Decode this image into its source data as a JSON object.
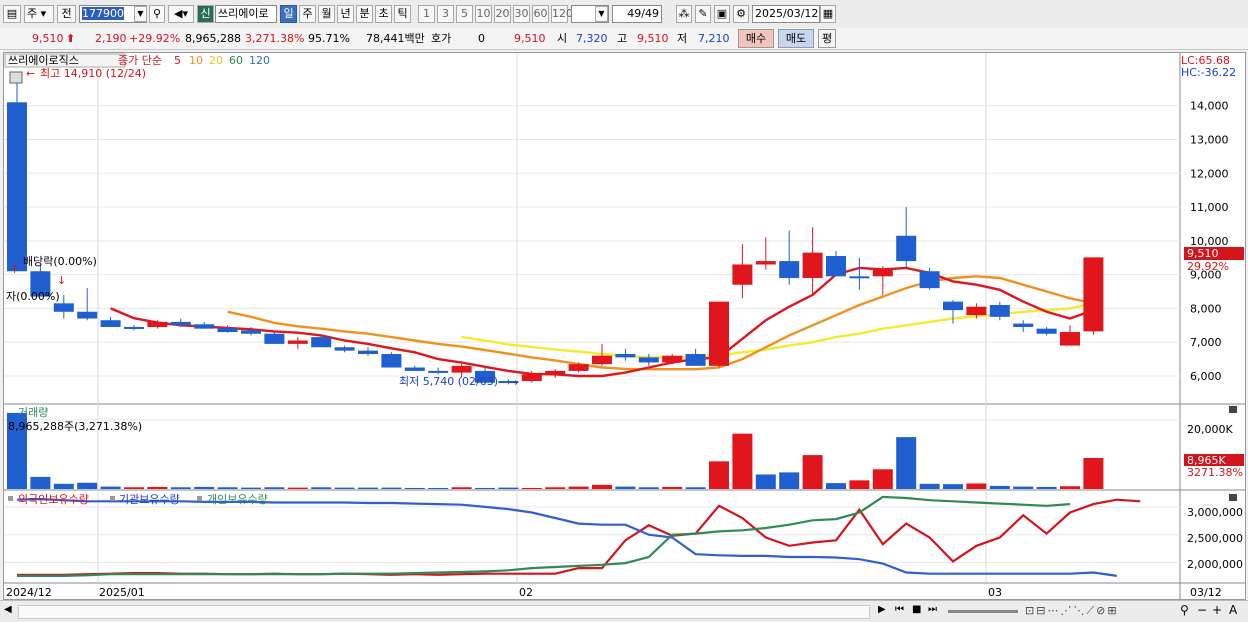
{
  "toolbar": {
    "market_type": "주",
    "mode": "전",
    "code": "177900",
    "badge_new": "신",
    "stock_name": "쓰리에이로",
    "periods": [
      "일",
      "주",
      "월",
      "년",
      "분",
      "초",
      "틱"
    ],
    "active_period": "일",
    "intervals": [
      "1",
      "3",
      "5",
      "10",
      "20",
      "30",
      "60",
      "120"
    ],
    "page_count": "49/49",
    "date": "2025/03/12"
  },
  "quote": {
    "price": "9,510",
    "change": "2,190",
    "change_pct": "+29.92%",
    "volume": "8,965,288",
    "volume_pct": "3,271.38%",
    "turnover_pct": "95.71%",
    "amount": "78,441백만",
    "hoga_label": "호가",
    "hoga_value": "0",
    "hoga_price": "9,510",
    "open_label": "시",
    "open": "7,320",
    "high_label": "고",
    "high": "9,510",
    "low_label": "저",
    "low": "7,210",
    "buy_button": "매수",
    "sell_button": "매도",
    "eval_button": "평"
  },
  "chart_header": {
    "stock_name": "쓰리에이로직스",
    "ma_label": "종가 단순",
    "ma_periods": [
      "5",
      "10",
      "20",
      "60",
      "120"
    ],
    "ma_colors": [
      "#e0161c",
      "#f0911e",
      "#f3ec2a",
      "#2e8b57",
      "#2f6bd6"
    ],
    "lc_label": "LC:65.68",
    "hc_label": "HC:-36.22"
  },
  "annotations": {
    "high_label": "최고 14,910 (12/24)",
    "low_label": "최저 5,740 (02/03)",
    "dividend_label": "배당락(0.00%)",
    "rights_label": "자(0.00%)"
  },
  "price_axis": {
    "ticks": [
      "14,000",
      "13,000",
      "12,000",
      "11,000",
      "10,000",
      "9,000",
      "8,000",
      "7,000",
      "6,000"
    ],
    "current_price_tag": "9,510",
    "current_pct_tag": "29.92%"
  },
  "volume_panel": {
    "title": "거래량",
    "subtitle": "8,965,288주(3,271.38%)",
    "axis_tick": "20,000K",
    "current_tag": "8,965K",
    "current_pct_tag": "3271.38%"
  },
  "holding_panel": {
    "legend": [
      "외국인보유수량",
      "기관보유수량",
      "개인보유수량"
    ],
    "axis_ticks": [
      "3,000,000",
      "2,500,000",
      "2,000,000"
    ]
  },
  "date_axis": [
    "2024/12",
    "2025/01",
    "02",
    "03",
    "03/12"
  ],
  "chart_data": {
    "type": "candlestick",
    "price": {
      "ylim": [
        5200,
        15500
      ],
      "candles": [
        {
          "o": 14100,
          "h": 14910,
          "l": 9100,
          "c": 9100
        },
        {
          "o": 9100,
          "h": 9300,
          "l": 8400,
          "c": 8350
        },
        {
          "o": 8150,
          "h": 8400,
          "l": 7700,
          "c": 7900
        },
        {
          "o": 7900,
          "h": 8600,
          "l": 7650,
          "c": 7700
        },
        {
          "o": 7650,
          "h": 7750,
          "l": 7450,
          "c": 7450
        },
        {
          "o": 7450,
          "h": 7500,
          "l": 7350,
          "c": 7420
        },
        {
          "o": 7450,
          "h": 7650,
          "l": 7400,
          "c": 7600
        },
        {
          "o": 7600,
          "h": 7700,
          "l": 7450,
          "c": 7500
        },
        {
          "o": 7530,
          "h": 7600,
          "l": 7400,
          "c": 7400
        },
        {
          "o": 7420,
          "h": 7500,
          "l": 7280,
          "c": 7300
        },
        {
          "o": 7350,
          "h": 7450,
          "l": 7200,
          "c": 7250
        },
        {
          "o": 7250,
          "h": 7300,
          "l": 6950,
          "c": 6950
        },
        {
          "o": 6950,
          "h": 7150,
          "l": 6800,
          "c": 7050
        },
        {
          "o": 7150,
          "h": 7200,
          "l": 6850,
          "c": 6850
        },
        {
          "o": 6850,
          "h": 6900,
          "l": 6700,
          "c": 6750
        },
        {
          "o": 6750,
          "h": 6850,
          "l": 6600,
          "c": 6650
        },
        {
          "o": 6650,
          "h": 6700,
          "l": 6250,
          "c": 6250
        },
        {
          "o": 6250,
          "h": 6300,
          "l": 6150,
          "c": 6150
        },
        {
          "o": 6150,
          "h": 6250,
          "l": 6050,
          "c": 6100
        },
        {
          "o": 6100,
          "h": 6350,
          "l": 5950,
          "c": 6300
        },
        {
          "o": 6150,
          "h": 6250,
          "l": 5740,
          "c": 5800
        },
        {
          "o": 5850,
          "h": 5900,
          "l": 5750,
          "c": 5800
        },
        {
          "o": 5850,
          "h": 6150,
          "l": 5800,
          "c": 6050
        },
        {
          "o": 6050,
          "h": 6200,
          "l": 5950,
          "c": 6150
        },
        {
          "o": 6150,
          "h": 6400,
          "l": 6100,
          "c": 6350
        },
        {
          "o": 6350,
          "h": 6950,
          "l": 6300,
          "c": 6600
        },
        {
          "o": 6650,
          "h": 6800,
          "l": 6450,
          "c": 6550
        },
        {
          "o": 6550,
          "h": 6650,
          "l": 6300,
          "c": 6400
        },
        {
          "o": 6400,
          "h": 6650,
          "l": 6350,
          "c": 6600
        },
        {
          "o": 6650,
          "h": 6800,
          "l": 6300,
          "c": 6300
        },
        {
          "o": 6300,
          "h": 8200,
          "l": 6250,
          "c": 8200
        },
        {
          "o": 8700,
          "h": 9900,
          "l": 8300,
          "c": 9300
        },
        {
          "o": 9300,
          "h": 10100,
          "l": 9150,
          "c": 9400
        },
        {
          "o": 9400,
          "h": 10300,
          "l": 8700,
          "c": 8900
        },
        {
          "o": 8900,
          "h": 10400,
          "l": 8400,
          "c": 9650
        },
        {
          "o": 9550,
          "h": 9700,
          "l": 8950,
          "c": 8950
        },
        {
          "o": 8950,
          "h": 9500,
          "l": 8550,
          "c": 8900
        },
        {
          "o": 8950,
          "h": 9250,
          "l": 8400,
          "c": 9150
        },
        {
          "o": 10150,
          "h": 11000,
          "l": 9200,
          "c": 9400
        },
        {
          "o": 9100,
          "h": 9200,
          "l": 8550,
          "c": 8600
        },
        {
          "o": 8200,
          "h": 8250,
          "l": 7550,
          "c": 7950
        },
        {
          "o": 7800,
          "h": 8150,
          "l": 7700,
          "c": 8050
        },
        {
          "o": 8100,
          "h": 8200,
          "l": 7650,
          "c": 7750
        },
        {
          "o": 7550,
          "h": 7650,
          "l": 7300,
          "c": 7450
        },
        {
          "o": 7400,
          "h": 7450,
          "l": 7200,
          "c": 7250
        },
        {
          "o": 6900,
          "h": 7500,
          "l": 6900,
          "c": 7300
        },
        {
          "o": 7320,
          "h": 9510,
          "l": 7210,
          "c": 9510
        }
      ],
      "ma5": [
        null,
        null,
        null,
        null,
        8000,
        7710,
        7580,
        7500,
        7460,
        7420,
        7380,
        7320,
        7280,
        7200,
        7050,
        6950,
        6820,
        6700,
        6500,
        6400,
        6270,
        6150,
        6060,
        6050,
        6000,
        6000,
        6100,
        6250,
        6400,
        6500,
        6550,
        7100,
        7650,
        8050,
        8400,
        9000,
        9200,
        9150,
        9200,
        9050,
        8800,
        8700,
        8550,
        8200,
        7900,
        7700,
        7950
      ],
      "ma10": [
        null,
        null,
        null,
        null,
        null,
        null,
        null,
        null,
        null,
        7900,
        7750,
        7570,
        7470,
        7400,
        7320,
        7250,
        7150,
        7050,
        6950,
        6870,
        6770,
        6660,
        6550,
        6460,
        6350,
        6250,
        6210,
        6200,
        6200,
        6200,
        6250,
        6500,
        6850,
        7200,
        7500,
        7800,
        8100,
        8350,
        8600,
        8800,
        8900,
        8950,
        8900,
        8700,
        8500,
        8300,
        8150
      ],
      "ma20": [
        null,
        null,
        null,
        null,
        null,
        null,
        null,
        null,
        null,
        null,
        null,
        null,
        null,
        null,
        null,
        null,
        null,
        null,
        null,
        7150,
        7050,
        6930,
        6860,
        6780,
        6720,
        6650,
        6600,
        6550,
        6550,
        6550,
        6600,
        6700,
        6780,
        6900,
        7000,
        7150,
        7250,
        7400,
        7500,
        7600,
        7700,
        7770,
        7830,
        7900,
        7950,
        8000,
        8150
      ]
    },
    "volume": {
      "ylim": [
        0,
        24000
      ],
      "unit": "K",
      "values": [
        22000,
        3500,
        1500,
        1800,
        700,
        500,
        600,
        500,
        600,
        500,
        400,
        500,
        400,
        500,
        400,
        400,
        400,
        300,
        300,
        500,
        300,
        400,
        300,
        500,
        700,
        1200,
        700,
        500,
        600,
        500,
        8000,
        16000,
        4200,
        4800,
        9800,
        1700,
        2500,
        5700,
        15000,
        1500,
        1400,
        1600,
        900,
        700,
        600,
        800,
        8965
      ],
      "up": [
        false,
        false,
        false,
        false,
        false,
        true,
        true,
        false,
        false,
        false,
        false,
        false,
        true,
        false,
        false,
        false,
        false,
        false,
        false,
        true,
        false,
        false,
        true,
        true,
        true,
        true,
        false,
        false,
        true,
        false,
        true,
        true,
        false,
        false,
        true,
        false,
        true,
        true,
        false,
        false,
        false,
        true,
        false,
        false,
        false,
        true,
        true
      ]
    },
    "holding": {
      "ylim": [
        1650000,
        3250000
      ],
      "series": [
        {
          "name": "외국인보유수량",
          "color": "#d4141c",
          "values": [
            1780000,
            1780000,
            1780000,
            1790000,
            1800000,
            1810000,
            1810000,
            1800000,
            1800000,
            1790000,
            1790000,
            1800000,
            1790000,
            1790000,
            1800000,
            1790000,
            1780000,
            1790000,
            1780000,
            1790000,
            1800000,
            1800000,
            1800000,
            1800000,
            1900000,
            1900000,
            2400000,
            2670000,
            2480000,
            2520000,
            3020000,
            2800000,
            2450000,
            2300000,
            2360000,
            2400000,
            2950000,
            2330000,
            2700000,
            2450000,
            2020000,
            2300000,
            2450000,
            2850000,
            2520000,
            2900000,
            3050000,
            3130000,
            3100000
          ]
        },
        {
          "name": "기관보유수량",
          "color": "#2f5ed6",
          "values": [
            3130000,
            3140000,
            3120000,
            3100000,
            3100000,
            3100000,
            3100000,
            3100000,
            3090000,
            3090000,
            3090000,
            3080000,
            3080000,
            3080000,
            3080000,
            3070000,
            3070000,
            3060000,
            3050000,
            3040000,
            3000000,
            2960000,
            2900000,
            2800000,
            2700000,
            2680000,
            2680000,
            2500000,
            2450000,
            2150000,
            2130000,
            2120000,
            2120000,
            2100000,
            2100000,
            2090000,
            2060000,
            1980000,
            1820000,
            1800000,
            1800000,
            1800000,
            1800000,
            1800000,
            1800000,
            1800000,
            1820000,
            1760000
          ]
        },
        {
          "name": "개인보유수량",
          "color": "#2e8b57",
          "values": [
            1760000,
            1760000,
            1760000,
            1770000,
            1790000,
            1790000,
            1790000,
            1790000,
            1790000,
            1790000,
            1790000,
            1790000,
            1790000,
            1790000,
            1800000,
            1800000,
            1800000,
            1810000,
            1820000,
            1830000,
            1840000,
            1860000,
            1900000,
            1920000,
            1940000,
            1960000,
            1990000,
            2100000,
            2500000,
            2520000,
            2560000,
            2580000,
            2620000,
            2680000,
            2760000,
            2780000,
            2900000,
            3180000,
            3160000,
            3120000,
            3100000,
            3080000,
            3060000,
            3040000,
            3020000,
            3050000
          ]
        }
      ]
    }
  }
}
